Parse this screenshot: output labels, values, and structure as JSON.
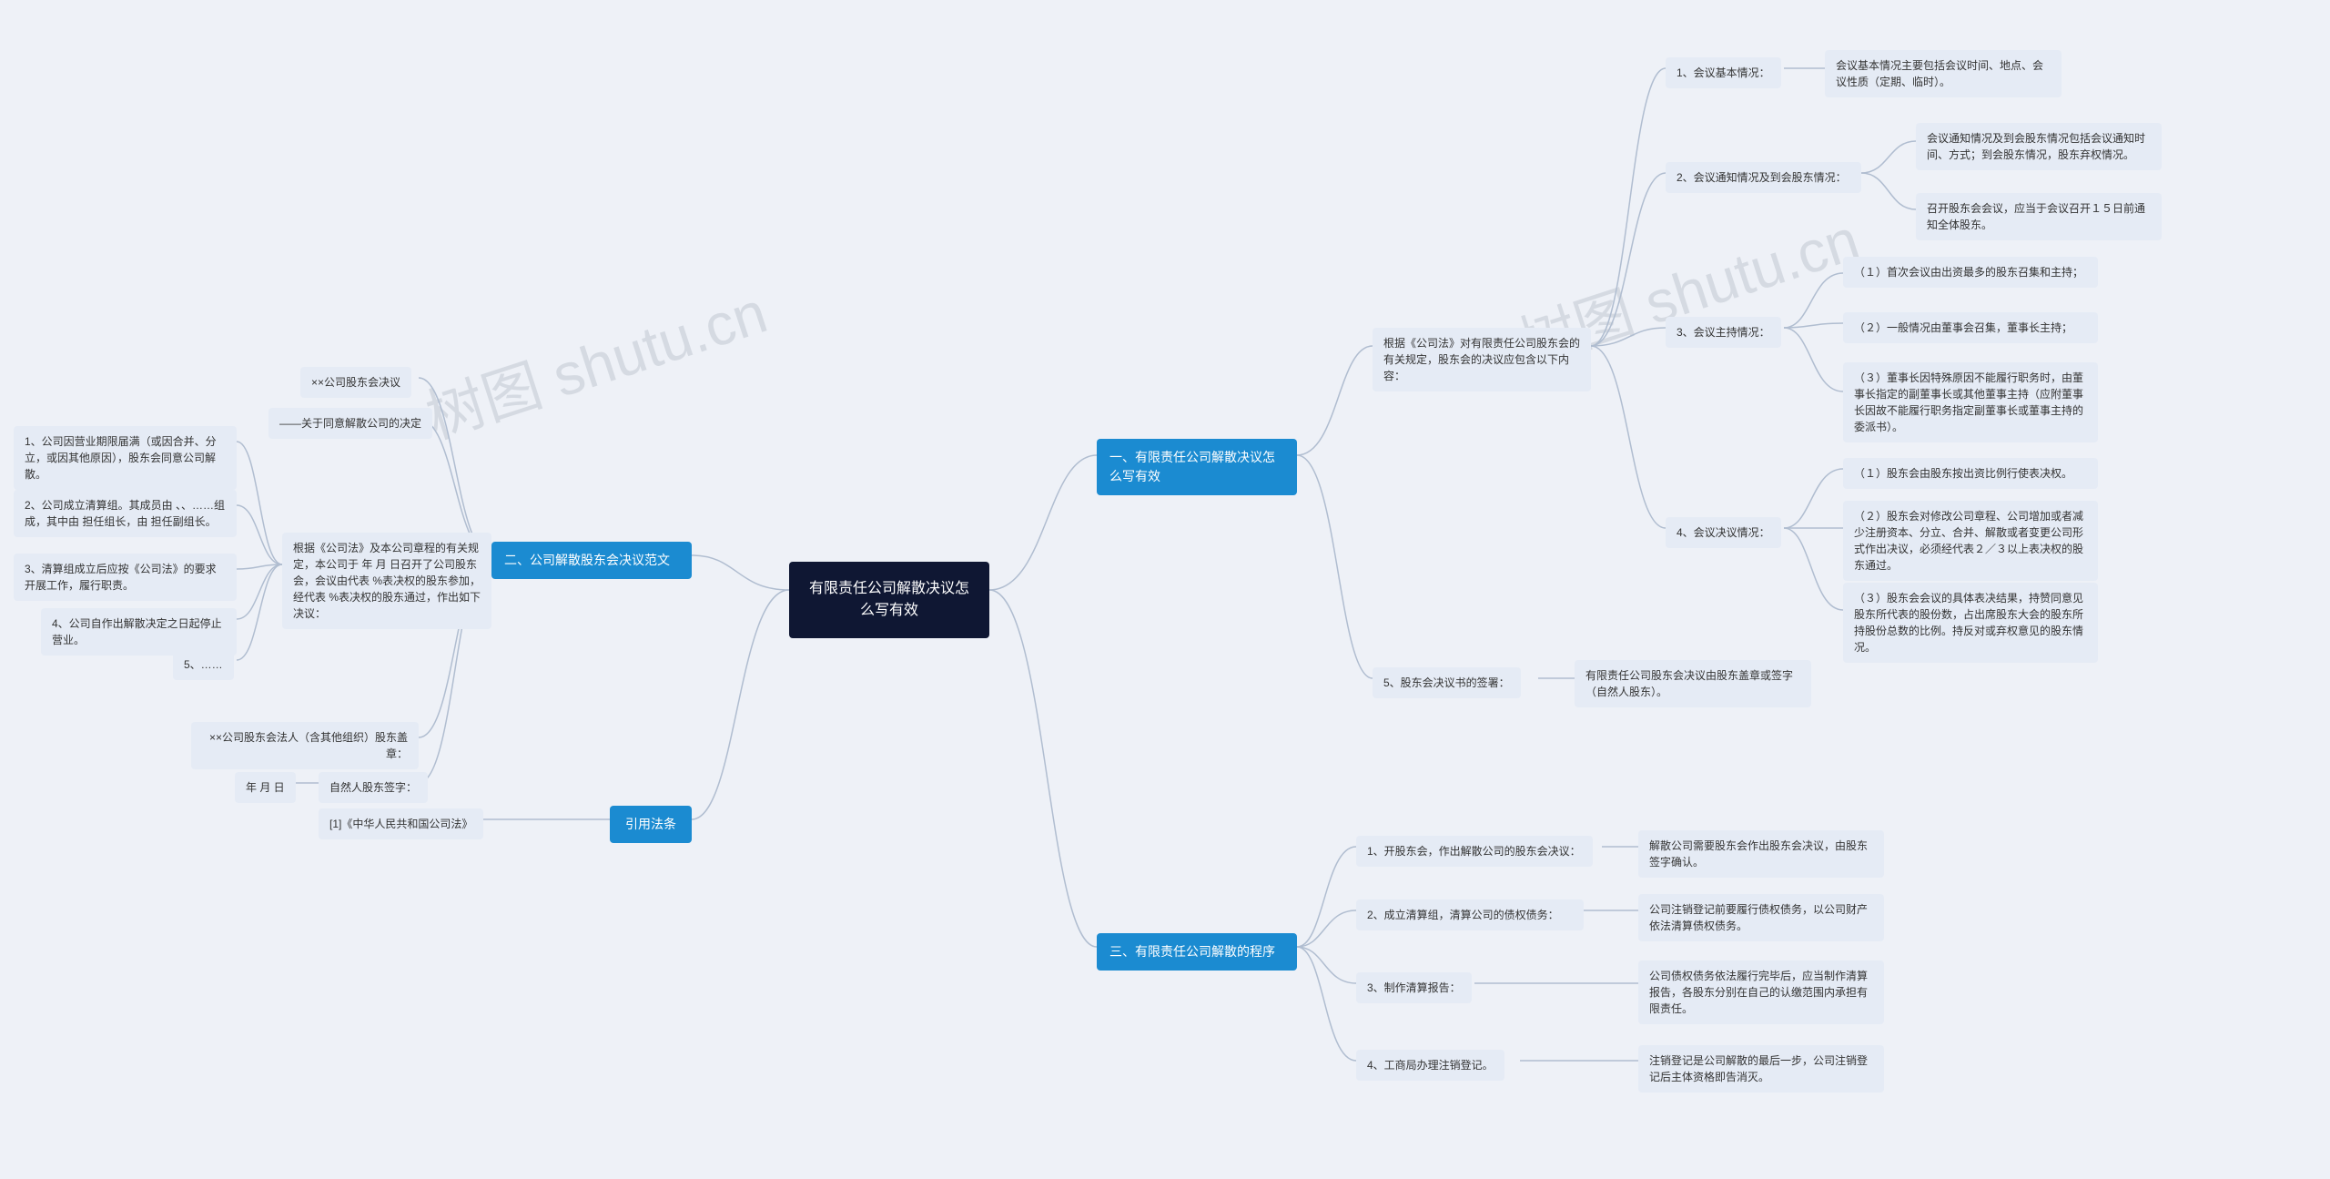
{
  "root": "有限责任公司解散决议怎么写有效",
  "branch1": {
    "title": "一、有限责任公司解散决议怎么写有效",
    "basis": "根据《公司法》对有限责任公司股东会的有关规定，股东会的决议应包含以下内容：",
    "item1": {
      "label": "1、会议基本情况：",
      "desc": "会议基本情况主要包括会议时间、地点、会议性质（定期、临时）。"
    },
    "item2": {
      "label": "2、会议通知情况及到会股东情况：",
      "desc1": "会议通知情况及到会股东情况包括会议通知时间、方式；到会股东情况，股东弃权情况。",
      "desc2": "召开股东会会议，应当于会议召开１５日前通知全体股东。"
    },
    "item3": {
      "label": "3、会议主持情况：",
      "desc1": "（１）首次会议由出资最多的股东召集和主持；",
      "desc2": "（２）一般情况由董事会召集，董事长主持；",
      "desc3": "（３）董事长因特殊原因不能履行职务时，由董事长指定的副董事长或其他董事主持（应附董事长因故不能履行职务指定副董事长或董事主持的委派书）。"
    },
    "item4": {
      "label": "4、会议决议情况：",
      "desc1": "（１）股东会由股东按出资比例行使表决权。",
      "desc2": "（２）股东会对修改公司章程、公司增加或者减少注册资本、分立、合并、解散或者变更公司形式作出决议，必须经代表２／３以上表决权的股东通过。",
      "desc3": "（３）股东会会议的具体表决结果，持赞同意见股东所代表的股份数，占出席股东大会的股东所持股份总数的比例。持反对或弃权意见的股东情况。"
    },
    "item5": {
      "label": "5、股东会决议书的签署：",
      "desc": "有限责任公司股东会决议由股东盖章或签字（自然人股东）。"
    }
  },
  "branch2": {
    "title": "二、公司解散股东会决议范文",
    "line1": "××公司股东会决议",
    "line2": "——关于同意解散公司的决定",
    "basis": "根据《公司法》及本公司章程的有关规定，本公司于 年 月 日召开了公司股东会，会议由代表 %表决权的股东参加，经代表 %表决权的股东通过，作出如下决议：",
    "d1": "1、公司因营业期限届满（或因合并、分立，或因其他原因），股东会同意公司解散。",
    "d2": "2、公司成立清算组。其成员由 、、……组成，其中由 担任组长，由 担任副组长。",
    "d3": "3、清算组成立后应按《公司法》的要求开展工作，履行职责。",
    "d4": "4、公司自作出解散决定之日起停止营业。",
    "d5": "5、……",
    "sign1": "××公司股东会法人（含其他组织）股东盖章：",
    "sign2label": "自然人股东签字：",
    "sign2date": "年 月 日"
  },
  "branch3": {
    "title": "三、有限责任公司解散的程序",
    "s1": {
      "label": "1、开股东会，作出解散公司的股东会决议：",
      "desc": "解散公司需要股东会作出股东会决议，由股东签字确认。"
    },
    "s2": {
      "label": "2、成立清算组，清算公司的债权债务：",
      "desc": "公司注销登记前要履行债权债务，以公司财产依法清算债权债务。"
    },
    "s3": {
      "label": "3、制作清算报告：",
      "desc": "公司债权债务依法履行完毕后，应当制作清算报告，各股东分别在自己的认缴范围内承担有限责任。"
    },
    "s4": {
      "label": "4、工商局办理注销登记。",
      "desc": "注销登记是公司解散的最后一步，公司注销登记后主体资格即告消灭。"
    }
  },
  "branch4": {
    "title": "引用法条",
    "ref": "[1]《中华人民共和国公司法》"
  },
  "watermark": "树图 shutu.cn"
}
